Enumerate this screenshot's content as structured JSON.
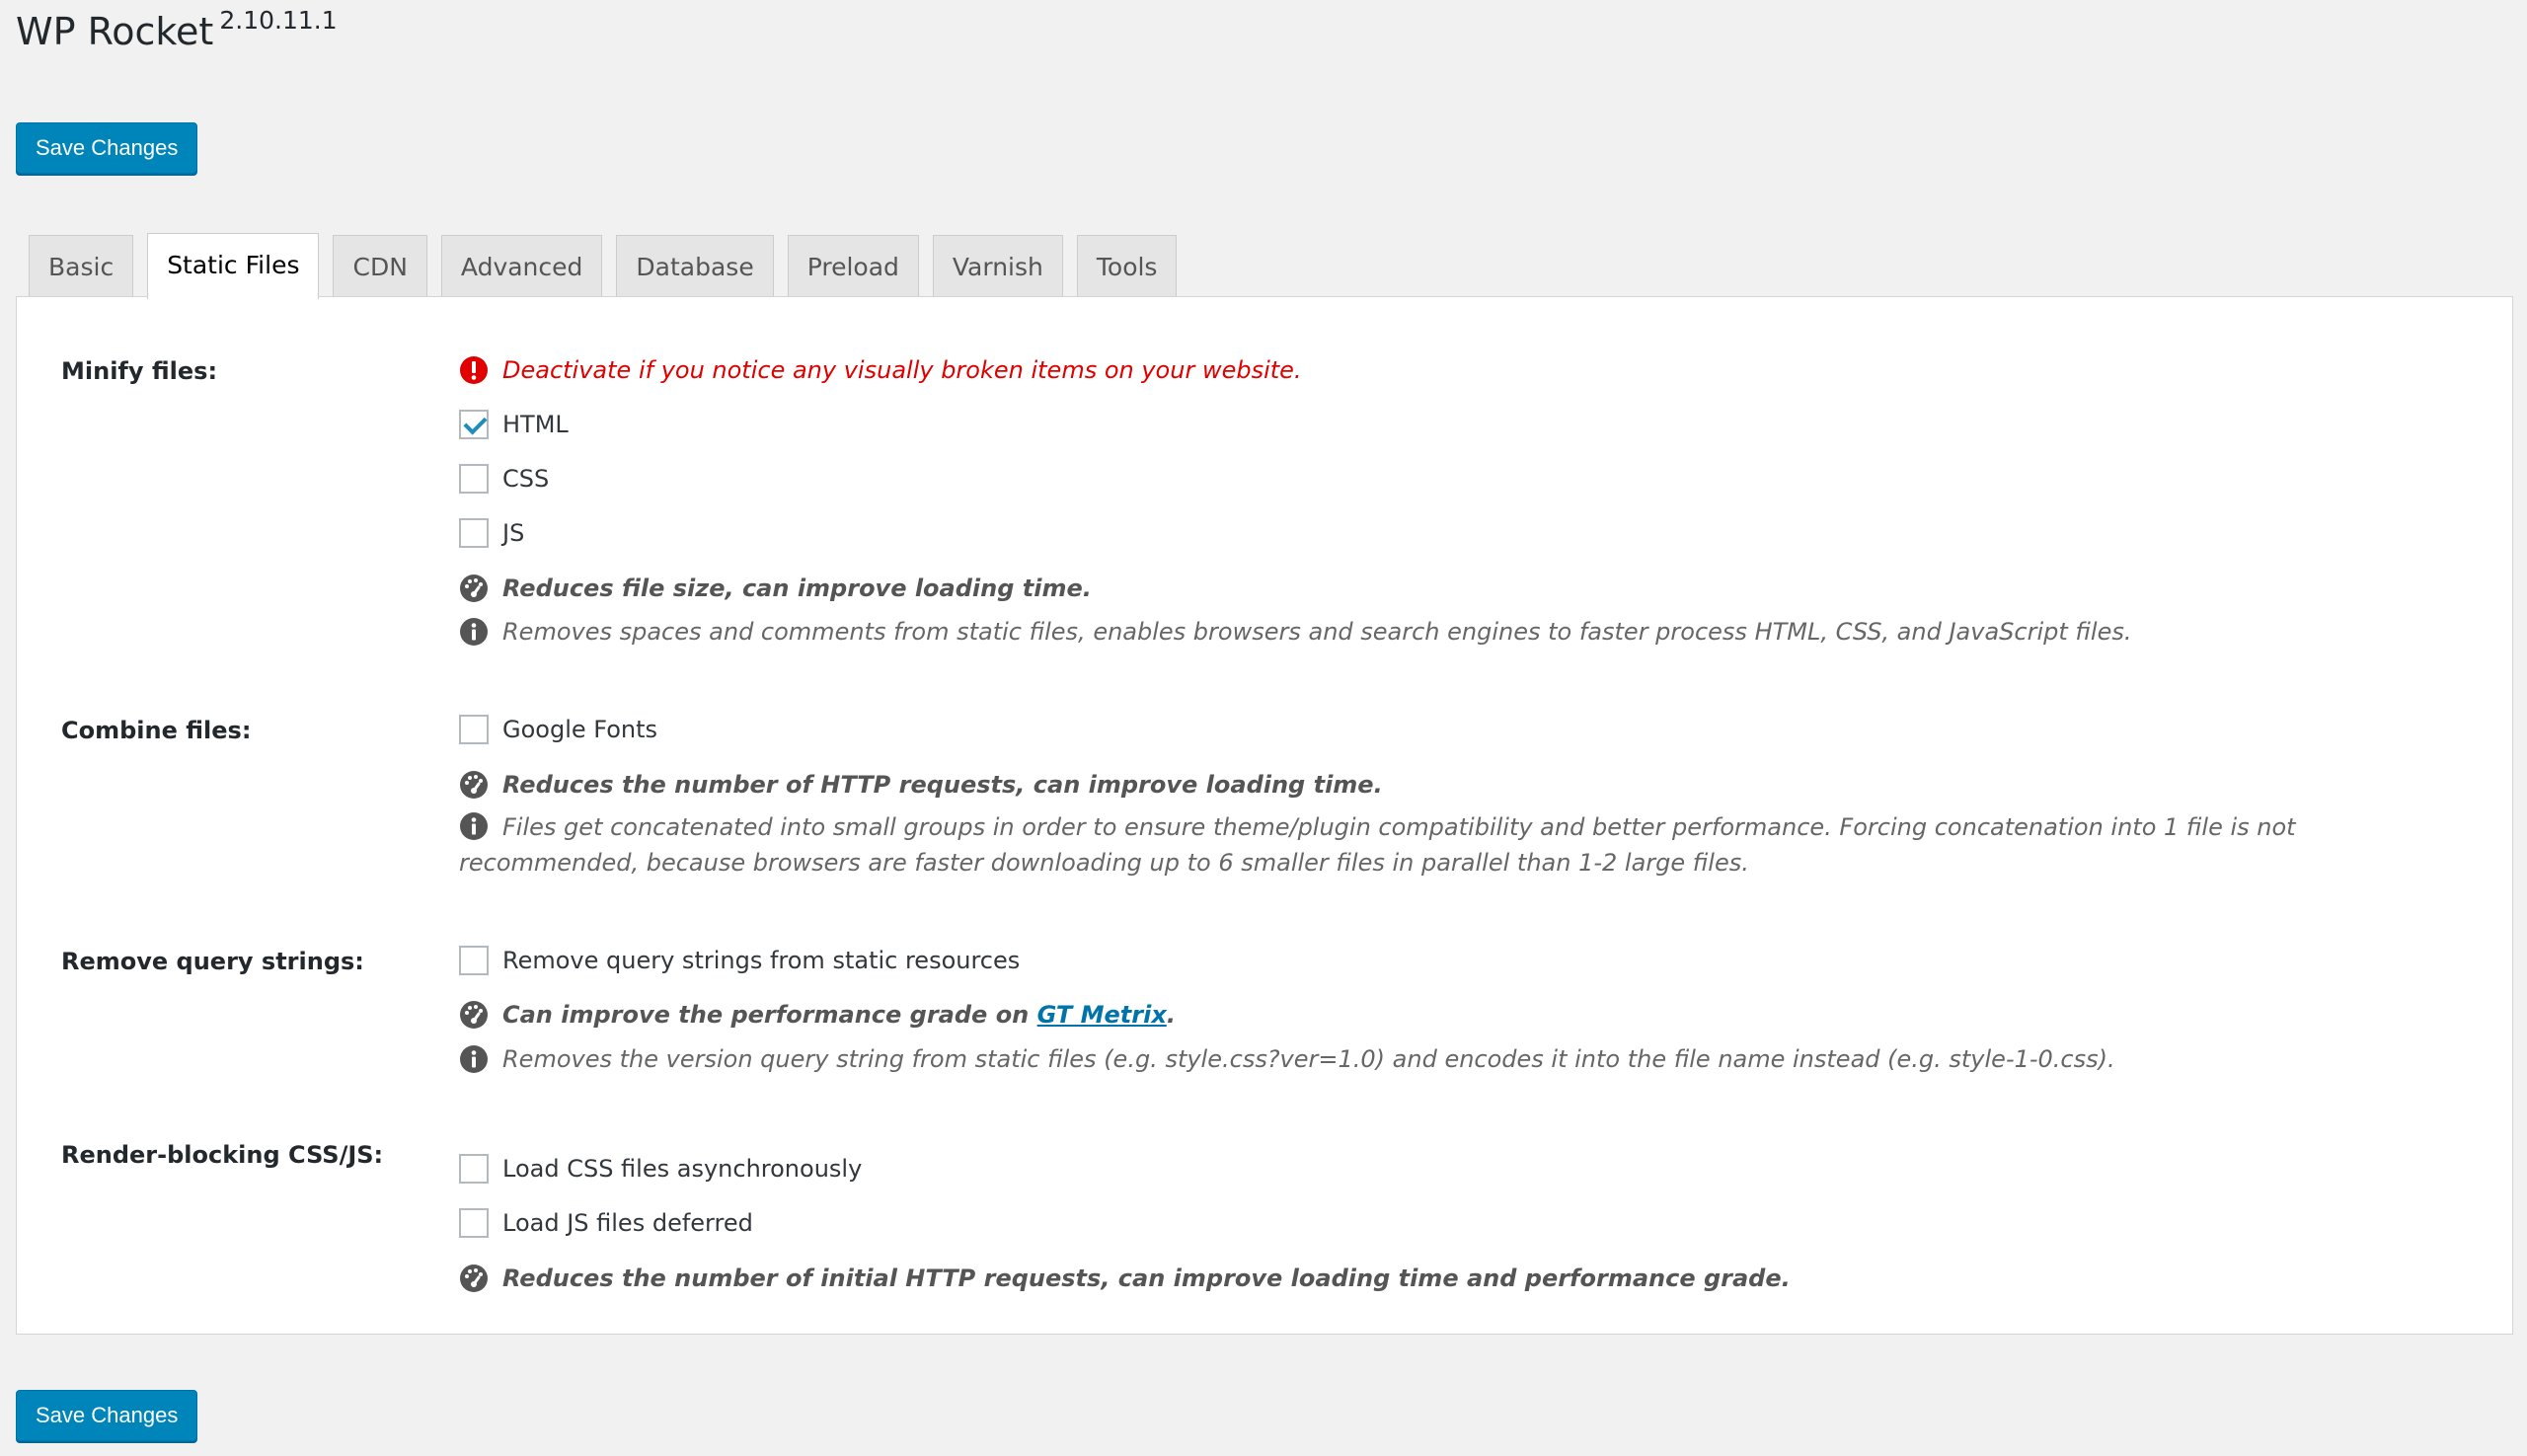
{
  "header": {
    "title": "WP Rocket",
    "version": "2.10.11.1",
    "save_label": "Save Changes"
  },
  "tabs": [
    "Basic",
    "Static Files",
    "CDN",
    "Advanced",
    "Database",
    "Preload",
    "Varnish",
    "Tools"
  ],
  "active_tab": "Static Files",
  "sections": {
    "minify": {
      "label": "Minify files:",
      "warning": "Deactivate if you notice any visually broken items on your website.",
      "options": [
        {
          "label": "HTML",
          "checked": true
        },
        {
          "label": "CSS",
          "checked": false
        },
        {
          "label": "JS",
          "checked": false
        }
      ],
      "perf": "Reduces file size, can improve loading time.",
      "info": "Removes spaces and comments from static files, enables browsers and search engines to faster process HTML, CSS, and JavaScript files."
    },
    "combine": {
      "label": "Combine files:",
      "options": [
        {
          "label": "Google Fonts",
          "checked": false
        }
      ],
      "perf": "Reduces the number of HTTP requests, can improve loading time.",
      "info": "Files get concatenated into small groups in order to ensure theme/plugin compatibility and better performance. Forcing concatenation into 1 file is not recommended, because browsers are faster downloading up to 6 smaller files in parallel than 1-2 large files."
    },
    "query": {
      "label": "Remove query strings:",
      "options": [
        {
          "label": "Remove query strings from static resources",
          "checked": false
        }
      ],
      "perf_prefix": "Can improve the performance grade on ",
      "perf_link": "GT Metrix",
      "perf_suffix": ".",
      "info": "Removes the version query string from static files (e.g. style.css?ver=1.0) and encodes it into the file name instead (e.g. style-1-0.css)."
    },
    "render": {
      "label": "Render-blocking CSS/JS:",
      "options": [
        {
          "label": "Load CSS files asynchronously",
          "checked": false
        },
        {
          "label": "Load JS files deferred",
          "checked": false
        }
      ],
      "perf": "Reduces the number of initial HTTP requests, can improve loading time and performance grade."
    }
  },
  "colors": {
    "primary": "#0085ba",
    "warning": "#e00000",
    "link": "#0073aa",
    "icon": "#555555"
  },
  "icons": {
    "warning": "exclamation-circle-icon",
    "performance": "speedometer-icon",
    "info": "info-circle-icon"
  }
}
